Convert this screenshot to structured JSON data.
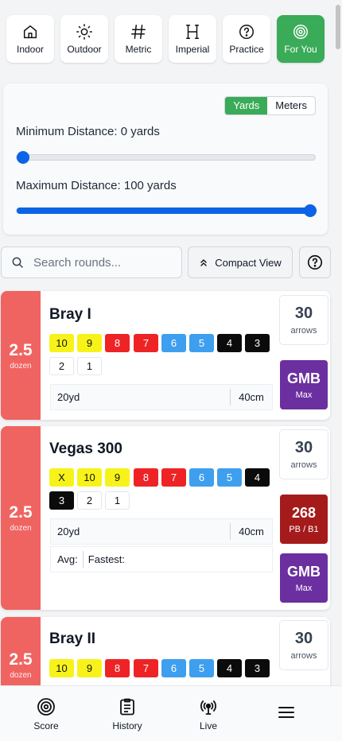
{
  "filters": [
    {
      "label": "Indoor",
      "icon": "home-icon",
      "active": false
    },
    {
      "label": "Outdoor",
      "icon": "sun-icon",
      "active": false
    },
    {
      "label": "Metric",
      "icon": "hash-icon",
      "active": false
    },
    {
      "label": "Imperial",
      "icon": "ruler-icon",
      "active": false
    },
    {
      "label": "Practice",
      "icon": "question-icon",
      "active": false
    },
    {
      "label": "For You",
      "icon": "target-icon",
      "active": true
    }
  ],
  "distance": {
    "unit_yards": "Yards",
    "unit_meters": "Meters",
    "selected_unit": "Yards",
    "min_label": "Minimum Distance: 0 yards",
    "max_label": "Maximum Distance: 100 yards",
    "min_value": 0,
    "max_value": 100,
    "range_max": 100
  },
  "search": {
    "placeholder": "Search rounds...",
    "compact_label": "Compact View",
    "help_icon": "question-circle-icon"
  },
  "rounds": [
    {
      "name": "Bray I",
      "dozen": "2.5",
      "dozen_unit": "dozen",
      "scores": [
        "10",
        "9",
        "8",
        "7",
        "6",
        "5",
        "4",
        "3",
        "2",
        "1"
      ],
      "distance": "20yd",
      "face": "40cm",
      "arrows": "30",
      "arrows_label": "arrows",
      "badges": [
        {
          "value": "GMB",
          "label": "Max",
          "color": "#6b2fa0"
        }
      ]
    },
    {
      "name": "Vegas 300",
      "dozen": "2.5",
      "dozen_unit": "dozen",
      "scores": [
        "X",
        "10",
        "9",
        "8",
        "7",
        "6",
        "5",
        "4",
        "3",
        "2",
        "1"
      ],
      "distance": "20yd",
      "face": "40cm",
      "avg_label": "Avg:",
      "fastest_label": "Fastest:",
      "arrows": "30",
      "arrows_label": "arrows",
      "badges": [
        {
          "value": "268",
          "label": "PB / B1",
          "color": "#a51b1b"
        },
        {
          "value": "GMB",
          "label": "Max",
          "color": "#6b2fa0"
        }
      ]
    },
    {
      "name": "Bray II",
      "dozen": "2.5",
      "dozen_unit": "dozen",
      "scores": [
        "10",
        "9",
        "8",
        "7",
        "6",
        "5",
        "4",
        "3"
      ],
      "arrows": "30",
      "arrows_label": "arrows"
    }
  ],
  "nav": [
    {
      "label": "Score",
      "icon": "target-icon"
    },
    {
      "label": "History",
      "icon": "clipboard-icon"
    },
    {
      "label": "Live",
      "icon": "broadcast-icon"
    },
    {
      "label": "",
      "icon": "menu-icon"
    }
  ]
}
